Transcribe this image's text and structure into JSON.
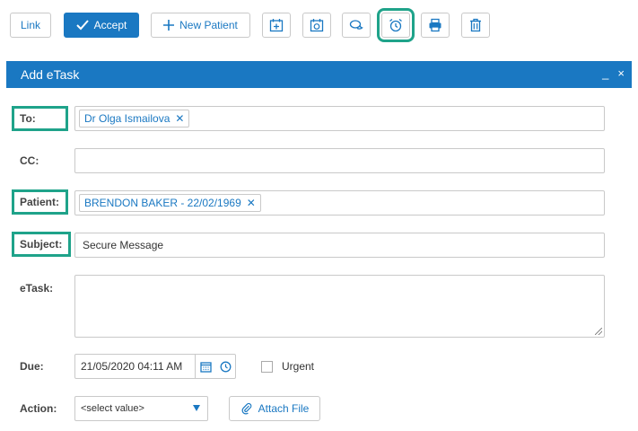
{
  "toolbar": {
    "link_label": "Link",
    "accept_label": "Accept",
    "new_patient_label": "New Patient"
  },
  "panel": {
    "title": "Add eTask",
    "minimize_symbol": "_",
    "close_symbol": "×"
  },
  "form": {
    "to_label": "To:",
    "to_recipient": "Dr Olga Ismailova",
    "cc_label": "CC:",
    "patient_label": "Patient:",
    "patient_value": "BRENDON BAKER - 22/02/1969",
    "subject_label": "Subject:",
    "subject_value": "Secure Message",
    "etask_label": "eTask:",
    "due_label": "Due:",
    "due_value": "21/05/2020 04:11 AM",
    "urgent_label": "Urgent",
    "action_label": "Action:",
    "action_value": "<select value>",
    "attach_label": "Attach File",
    "remove_symbol": "✕"
  },
  "colors": {
    "accent": "#1a78c2",
    "highlight": "#1fa38a"
  },
  "icons": [
    "check-icon",
    "plus-icon",
    "calendar-add-icon",
    "calendar-recurring-icon",
    "chat-icon",
    "alarm-clock-icon",
    "printer-icon",
    "trash-icon",
    "calendar-icon",
    "clock-icon",
    "paperclip-icon"
  ]
}
